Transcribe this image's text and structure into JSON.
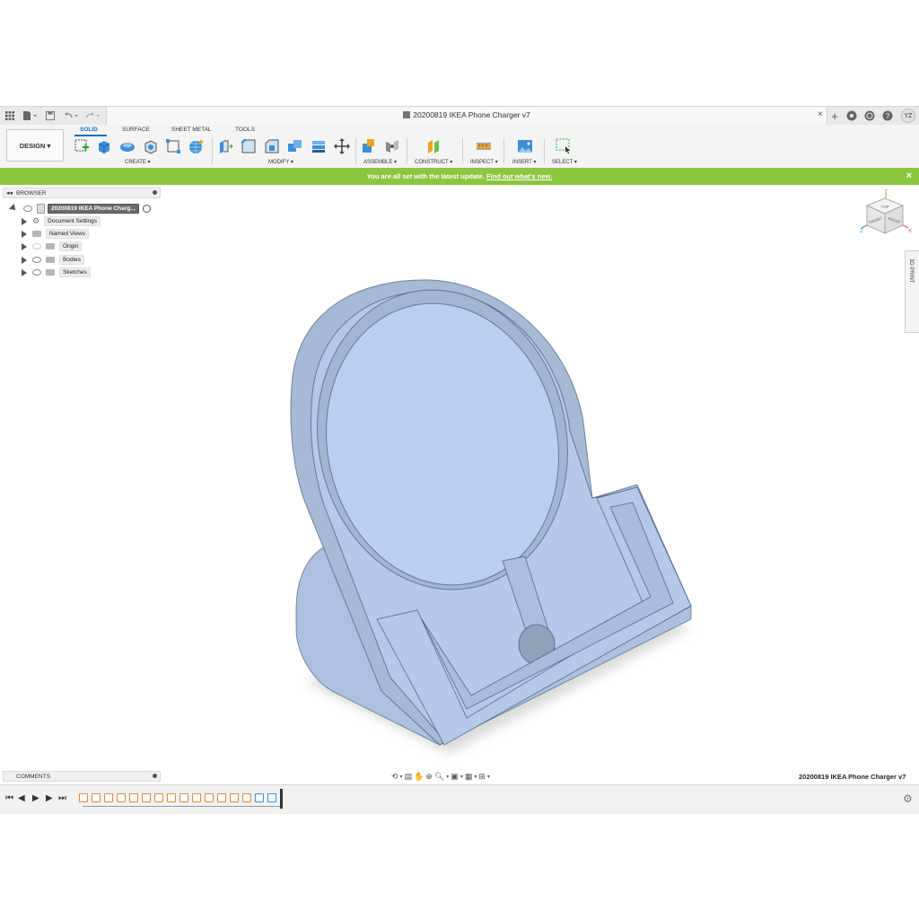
{
  "window": {
    "doc_title": "20200819 IKEA Phone Charger v7",
    "close_tab": "×",
    "avatar": "YZ"
  },
  "toolbar": {
    "workspace_button": "DESIGN ▾",
    "tabs": [
      "SOLID",
      "SURFACE",
      "SHEET METAL",
      "TOOLS"
    ],
    "active_tab": "SOLID",
    "groups": [
      "CREATE ▾",
      "MODIFY ▾",
      "ASSEMBLE ▾",
      "CONSTRUCT ▾",
      "INSPECT ▾",
      "INSERT ▾",
      "SELECT ▾"
    ]
  },
  "banner": {
    "text": "You are all set with the latest update.",
    "link": "Find out what's new.",
    "close": "×",
    "color": "#8cc63f"
  },
  "browser": {
    "title": "BROWSER",
    "root": "20200819 IKEA Phone Charg...",
    "items": [
      "Document Settings",
      "Named Views",
      "Origin",
      "Bodies",
      "Sketches"
    ]
  },
  "viewcube": {
    "faces": [
      "TOP",
      "FRONT",
      "RIGHT"
    ],
    "axes": [
      "Y",
      "Z",
      "X"
    ]
  },
  "side_panel": {
    "label": "3D PRINT"
  },
  "bottom": {
    "comments": "COMMENTS",
    "doc_label": "20200819 IKEA Phone Charger v7"
  },
  "model": {
    "fill_color": "#b4c9e8",
    "edge_color": "#2c3e6b"
  }
}
